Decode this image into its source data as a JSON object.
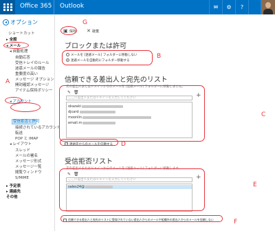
{
  "topbar": {
    "app": "Office 365",
    "product": "Outlook",
    "icons": [
      "mail-icon",
      "gear-icon",
      "help-icon"
    ]
  },
  "sidebar": {
    "title": "オプション",
    "items": [
      {
        "label": "ショートカット"
      },
      {
        "label": "▸ 全般"
      },
      {
        "label": "◂ メール"
      },
      {
        "label": "◂ 自動処理"
      },
      {
        "label": "自動応答"
      },
      {
        "label": "受信トレイのルール"
      },
      {
        "label": "迷惑メールの報告"
      },
      {
        "label": "重要度の高い"
      },
      {
        "label": "メッセージ オプション"
      },
      {
        "label": "開封確認メッセージ"
      },
      {
        "label": "アイテム保持ポリシー"
      },
      {
        "label": "◂ アカウント"
      },
      {
        "label": "受信拒否と許可"
      },
      {
        "label": "接続されているアカウント"
      },
      {
        "label": "転送"
      },
      {
        "label": "POP と IMAP"
      },
      {
        "label": "◂ レイアウト"
      },
      {
        "label": "スレッド"
      },
      {
        "label": "メールの署名"
      },
      {
        "label": "メッセージ形式"
      },
      {
        "label": "メッセージ一覧"
      },
      {
        "label": "閲覧ウィンドウ"
      },
      {
        "label": "S/MIME"
      },
      {
        "label": "▸ 予定表"
      },
      {
        "label": "▸ 連絡先"
      },
      {
        "label": "その他"
      }
    ]
  },
  "toolbar": {
    "save": "保存",
    "discard": "破棄"
  },
  "block_allow": {
    "title": "ブロックまたは許可",
    "option1": "メールを [迷惑メール] フォルダーに移動しない",
    "option2": "迷惑メールを自動的にフォルダー移動する"
  },
  "safe_senders": {
    "title": "信頼できる差出人と宛先のリスト",
    "desc": "次の差出人またはドメインからのメールを [迷惑メール] フォルダーに移動しません。",
    "placeholder": "ここに差出人またはドメインを入力してください",
    "entries": [
      "okazaki",
      "djcard",
      "moonlin",
      "email.m"
    ],
    "trust_contacts": "連絡先からのメールを信頼する"
  },
  "blocked_senders": {
    "title": "受信拒否リスト",
    "desc": "次の差出人またはドメインからのメールを [迷惑メール] フォルダーに移動します。",
    "placeholder": "ここに差出人またはドメインを入力してください",
    "entries": [
      "sales24@"
    ],
    "only_trusted": "信頼できる差出人と宛先のリストに登録されていない差出人からのメールや組織外の差出人からのメールを信頼しない"
  },
  "annotations": {
    "A": "A",
    "B": "B",
    "C": "C",
    "D": "D",
    "E": "E",
    "F": "F",
    "G": "G"
  },
  "colors": {
    "brand": "#0072c6",
    "annotation": "#e8313a"
  }
}
